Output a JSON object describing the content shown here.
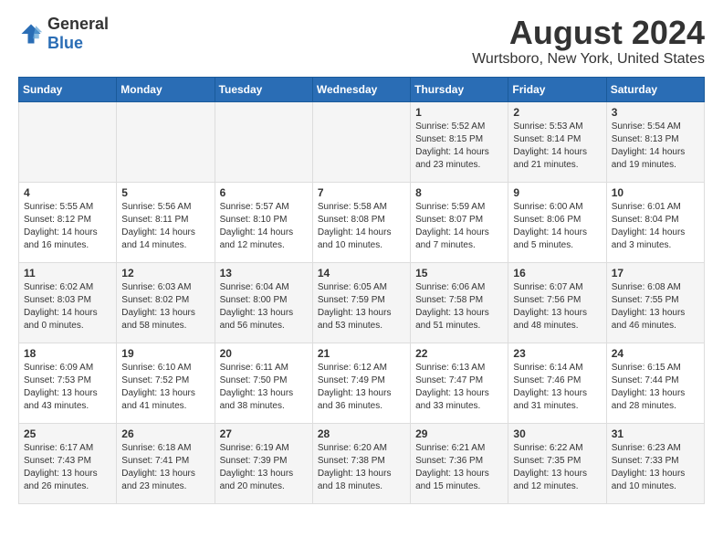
{
  "logo": {
    "general": "General",
    "blue": "Blue"
  },
  "header": {
    "title": "August 2024",
    "subtitle": "Wurtsboro, New York, United States"
  },
  "weekdays": [
    "Sunday",
    "Monday",
    "Tuesday",
    "Wednesday",
    "Thursday",
    "Friday",
    "Saturday"
  ],
  "weeks": [
    [
      {
        "day": "",
        "content": ""
      },
      {
        "day": "",
        "content": ""
      },
      {
        "day": "",
        "content": ""
      },
      {
        "day": "",
        "content": ""
      },
      {
        "day": "1",
        "content": "Sunrise: 5:52 AM\nSunset: 8:15 PM\nDaylight: 14 hours\nand 23 minutes."
      },
      {
        "day": "2",
        "content": "Sunrise: 5:53 AM\nSunset: 8:14 PM\nDaylight: 14 hours\nand 21 minutes."
      },
      {
        "day": "3",
        "content": "Sunrise: 5:54 AM\nSunset: 8:13 PM\nDaylight: 14 hours\nand 19 minutes."
      }
    ],
    [
      {
        "day": "4",
        "content": "Sunrise: 5:55 AM\nSunset: 8:12 PM\nDaylight: 14 hours\nand 16 minutes."
      },
      {
        "day": "5",
        "content": "Sunrise: 5:56 AM\nSunset: 8:11 PM\nDaylight: 14 hours\nand 14 minutes."
      },
      {
        "day": "6",
        "content": "Sunrise: 5:57 AM\nSunset: 8:10 PM\nDaylight: 14 hours\nand 12 minutes."
      },
      {
        "day": "7",
        "content": "Sunrise: 5:58 AM\nSunset: 8:08 PM\nDaylight: 14 hours\nand 10 minutes."
      },
      {
        "day": "8",
        "content": "Sunrise: 5:59 AM\nSunset: 8:07 PM\nDaylight: 14 hours\nand 7 minutes."
      },
      {
        "day": "9",
        "content": "Sunrise: 6:00 AM\nSunset: 8:06 PM\nDaylight: 14 hours\nand 5 minutes."
      },
      {
        "day": "10",
        "content": "Sunrise: 6:01 AM\nSunset: 8:04 PM\nDaylight: 14 hours\nand 3 minutes."
      }
    ],
    [
      {
        "day": "11",
        "content": "Sunrise: 6:02 AM\nSunset: 8:03 PM\nDaylight: 14 hours\nand 0 minutes."
      },
      {
        "day": "12",
        "content": "Sunrise: 6:03 AM\nSunset: 8:02 PM\nDaylight: 13 hours\nand 58 minutes."
      },
      {
        "day": "13",
        "content": "Sunrise: 6:04 AM\nSunset: 8:00 PM\nDaylight: 13 hours\nand 56 minutes."
      },
      {
        "day": "14",
        "content": "Sunrise: 6:05 AM\nSunset: 7:59 PM\nDaylight: 13 hours\nand 53 minutes."
      },
      {
        "day": "15",
        "content": "Sunrise: 6:06 AM\nSunset: 7:58 PM\nDaylight: 13 hours\nand 51 minutes."
      },
      {
        "day": "16",
        "content": "Sunrise: 6:07 AM\nSunset: 7:56 PM\nDaylight: 13 hours\nand 48 minutes."
      },
      {
        "day": "17",
        "content": "Sunrise: 6:08 AM\nSunset: 7:55 PM\nDaylight: 13 hours\nand 46 minutes."
      }
    ],
    [
      {
        "day": "18",
        "content": "Sunrise: 6:09 AM\nSunset: 7:53 PM\nDaylight: 13 hours\nand 43 minutes."
      },
      {
        "day": "19",
        "content": "Sunrise: 6:10 AM\nSunset: 7:52 PM\nDaylight: 13 hours\nand 41 minutes."
      },
      {
        "day": "20",
        "content": "Sunrise: 6:11 AM\nSunset: 7:50 PM\nDaylight: 13 hours\nand 38 minutes."
      },
      {
        "day": "21",
        "content": "Sunrise: 6:12 AM\nSunset: 7:49 PM\nDaylight: 13 hours\nand 36 minutes."
      },
      {
        "day": "22",
        "content": "Sunrise: 6:13 AM\nSunset: 7:47 PM\nDaylight: 13 hours\nand 33 minutes."
      },
      {
        "day": "23",
        "content": "Sunrise: 6:14 AM\nSunset: 7:46 PM\nDaylight: 13 hours\nand 31 minutes."
      },
      {
        "day": "24",
        "content": "Sunrise: 6:15 AM\nSunset: 7:44 PM\nDaylight: 13 hours\nand 28 minutes."
      }
    ],
    [
      {
        "day": "25",
        "content": "Sunrise: 6:17 AM\nSunset: 7:43 PM\nDaylight: 13 hours\nand 26 minutes."
      },
      {
        "day": "26",
        "content": "Sunrise: 6:18 AM\nSunset: 7:41 PM\nDaylight: 13 hours\nand 23 minutes."
      },
      {
        "day": "27",
        "content": "Sunrise: 6:19 AM\nSunset: 7:39 PM\nDaylight: 13 hours\nand 20 minutes."
      },
      {
        "day": "28",
        "content": "Sunrise: 6:20 AM\nSunset: 7:38 PM\nDaylight: 13 hours\nand 18 minutes."
      },
      {
        "day": "29",
        "content": "Sunrise: 6:21 AM\nSunset: 7:36 PM\nDaylight: 13 hours\nand 15 minutes."
      },
      {
        "day": "30",
        "content": "Sunrise: 6:22 AM\nSunset: 7:35 PM\nDaylight: 13 hours\nand 12 minutes."
      },
      {
        "day": "31",
        "content": "Sunrise: 6:23 AM\nSunset: 7:33 PM\nDaylight: 13 hours\nand 10 minutes."
      }
    ]
  ]
}
